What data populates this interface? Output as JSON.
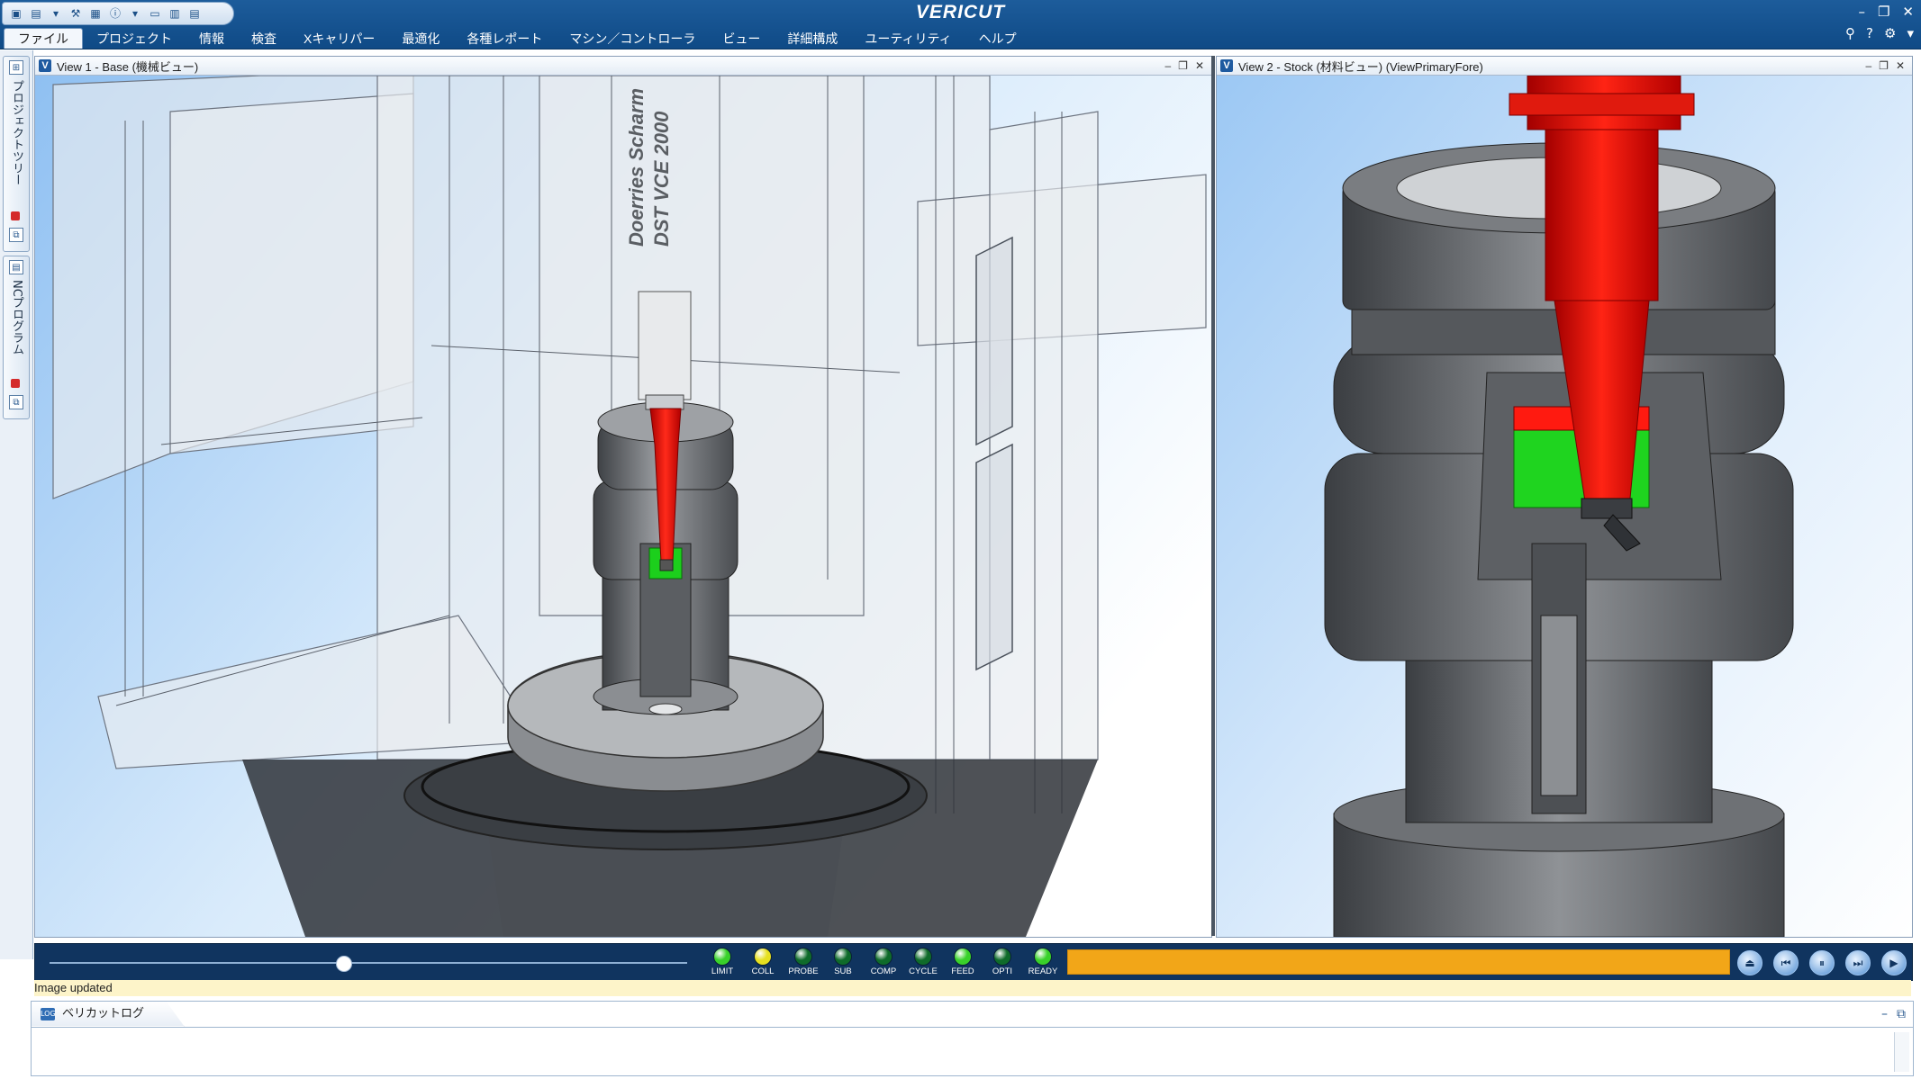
{
  "app": {
    "title": "VERICUT"
  },
  "menu": {
    "items": [
      "ファイル",
      "プロジェクト",
      "情報",
      "検査",
      "Xキャリパー",
      "最適化",
      "各種レポート",
      "マシン／コントローラ",
      "ビュー",
      "詳細構成",
      "ユーティリティ",
      "ヘルプ"
    ]
  },
  "dock": {
    "project_tree": "プロジェクトツリー",
    "nc_program": "NCプログラム"
  },
  "views": {
    "view1": {
      "title": "View 1 - Base (機械ビュー)",
      "machine_label_line1": "Doerries Scharm",
      "machine_label_line2": "DST VCE 2000"
    },
    "view2": {
      "title": "View 2 - Stock (材料ビュー) (ViewPrimaryFore)"
    }
  },
  "playback": {
    "slider_position": 0.46,
    "progress": 1.0,
    "indicators": [
      {
        "label": "LIMIT",
        "color": "#39d12a"
      },
      {
        "label": "COLL",
        "color": "#e6e020"
      },
      {
        "label": "PROBE",
        "color": "#0f6b2a"
      },
      {
        "label": "SUB",
        "color": "#0f6b2a"
      },
      {
        "label": "COMP",
        "color": "#0f6b2a"
      },
      {
        "label": "CYCLE",
        "color": "#0f6b2a"
      },
      {
        "label": "FEED",
        "color": "#39d12a"
      },
      {
        "label": "OPTI",
        "color": "#0f6b2a"
      },
      {
        "label": "READY",
        "color": "#39d12a"
      }
    ]
  },
  "status": {
    "message": "Image updated"
  },
  "log": {
    "tab_label": "ベリカットログ"
  }
}
